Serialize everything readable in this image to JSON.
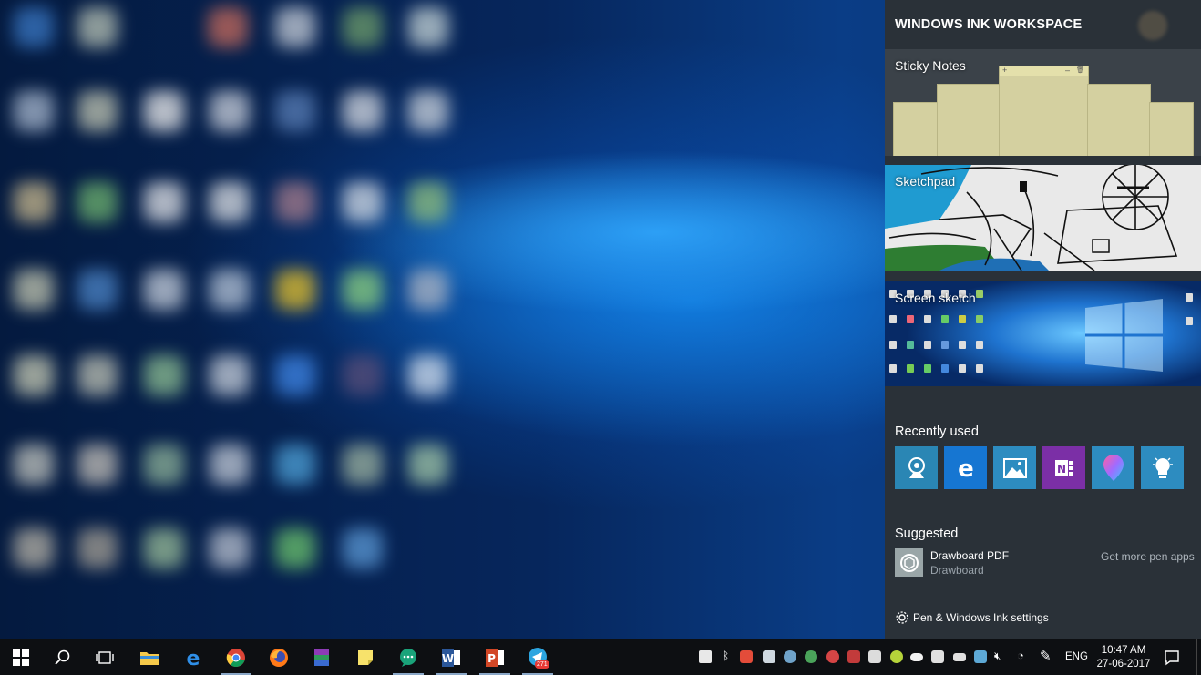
{
  "panel": {
    "title": "WINDOWS INK WORKSPACE",
    "tiles": {
      "sticky_notes": "Sticky Notes",
      "sketchpad": "Sketchpad",
      "screen_sketch": "Screen sketch"
    },
    "note_bar": {
      "add": "+",
      "minimize": "–",
      "delete": "🗑"
    },
    "recently_used_title": "Recently used",
    "recent_apps": [
      "webcam-app-icon",
      "edge-icon",
      "photos-icon",
      "onenote-icon",
      "paint3d-icon",
      "tips-icon"
    ],
    "suggested_title": "Suggested",
    "suggested_app": {
      "name": "Drawboard PDF",
      "publisher": "Drawboard"
    },
    "get_more": "Get more pen apps",
    "settings_label": "Pen & Windows Ink settings"
  },
  "taskbar": {
    "language": "ENG",
    "time": "10:47 AM",
    "date": "27-06-2017",
    "telegram_badge": "271"
  },
  "colors": {
    "panel_bg": "#2a3138",
    "tile_blue": "#1f8ac9",
    "onenote_purple": "#7b2fa6",
    "sticky_yellow": "#d4d0a0"
  }
}
